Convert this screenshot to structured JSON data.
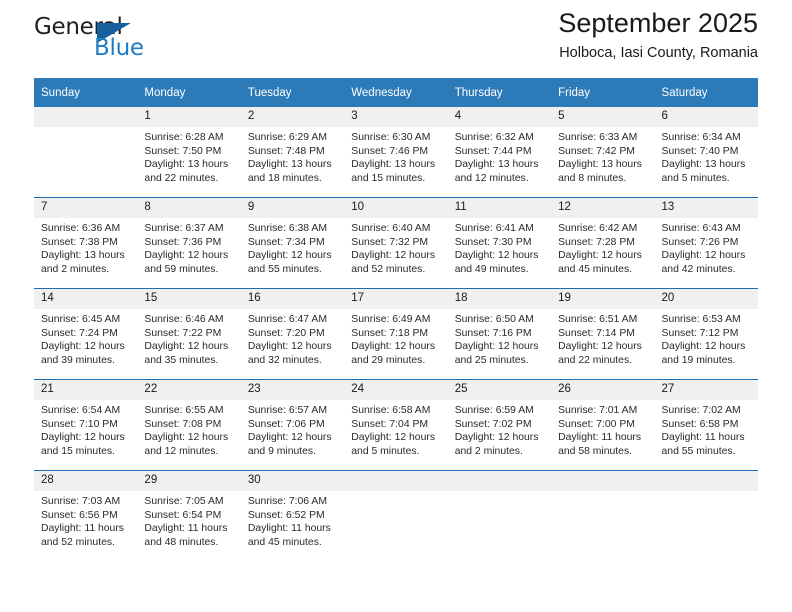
{
  "brand": {
    "word_one": "General",
    "word_two": "Blue",
    "triangle_icon": "blue-triangle-icon"
  },
  "header": {
    "month_title": "September 2025",
    "location": "Holboca, Iasi County, Romania"
  },
  "colors": {
    "header_blue": "#2d7ab8",
    "week_divider_blue": "#1f6cb0",
    "daynum_band": "#f0f0f0",
    "brand_blue": "#1f7cc4",
    "brand_dark": "#231f20",
    "text": "#1a1a1a"
  },
  "calendar": {
    "weekday_headers": [
      "Sunday",
      "Monday",
      "Tuesday",
      "Wednesday",
      "Thursday",
      "Friday",
      "Saturday"
    ],
    "weeks": [
      [
        {
          "day": "",
          "empty": true,
          "sunrise": "",
          "sunset": "",
          "daylight_line1": "",
          "daylight_line2": ""
        },
        {
          "day": "1",
          "sunrise": "Sunrise: 6:28 AM",
          "sunset": "Sunset: 7:50 PM",
          "daylight_line1": "Daylight: 13 hours",
          "daylight_line2": "and 22 minutes."
        },
        {
          "day": "2",
          "sunrise": "Sunrise: 6:29 AM",
          "sunset": "Sunset: 7:48 PM",
          "daylight_line1": "Daylight: 13 hours",
          "daylight_line2": "and 18 minutes."
        },
        {
          "day": "3",
          "sunrise": "Sunrise: 6:30 AM",
          "sunset": "Sunset: 7:46 PM",
          "daylight_line1": "Daylight: 13 hours",
          "daylight_line2": "and 15 minutes."
        },
        {
          "day": "4",
          "sunrise": "Sunrise: 6:32 AM",
          "sunset": "Sunset: 7:44 PM",
          "daylight_line1": "Daylight: 13 hours",
          "daylight_line2": "and 12 minutes."
        },
        {
          "day": "5",
          "sunrise": "Sunrise: 6:33 AM",
          "sunset": "Sunset: 7:42 PM",
          "daylight_line1": "Daylight: 13 hours",
          "daylight_line2": "and 8 minutes."
        },
        {
          "day": "6",
          "sunrise": "Sunrise: 6:34 AM",
          "sunset": "Sunset: 7:40 PM",
          "daylight_line1": "Daylight: 13 hours",
          "daylight_line2": "and 5 minutes."
        }
      ],
      [
        {
          "day": "7",
          "sunrise": "Sunrise: 6:36 AM",
          "sunset": "Sunset: 7:38 PM",
          "daylight_line1": "Daylight: 13 hours",
          "daylight_line2": "and 2 minutes."
        },
        {
          "day": "8",
          "sunrise": "Sunrise: 6:37 AM",
          "sunset": "Sunset: 7:36 PM",
          "daylight_line1": "Daylight: 12 hours",
          "daylight_line2": "and 59 minutes."
        },
        {
          "day": "9",
          "sunrise": "Sunrise: 6:38 AM",
          "sunset": "Sunset: 7:34 PM",
          "daylight_line1": "Daylight: 12 hours",
          "daylight_line2": "and 55 minutes."
        },
        {
          "day": "10",
          "sunrise": "Sunrise: 6:40 AM",
          "sunset": "Sunset: 7:32 PM",
          "daylight_line1": "Daylight: 12 hours",
          "daylight_line2": "and 52 minutes."
        },
        {
          "day": "11",
          "sunrise": "Sunrise: 6:41 AM",
          "sunset": "Sunset: 7:30 PM",
          "daylight_line1": "Daylight: 12 hours",
          "daylight_line2": "and 49 minutes."
        },
        {
          "day": "12",
          "sunrise": "Sunrise: 6:42 AM",
          "sunset": "Sunset: 7:28 PM",
          "daylight_line1": "Daylight: 12 hours",
          "daylight_line2": "and 45 minutes."
        },
        {
          "day": "13",
          "sunrise": "Sunrise: 6:43 AM",
          "sunset": "Sunset: 7:26 PM",
          "daylight_line1": "Daylight: 12 hours",
          "daylight_line2": "and 42 minutes."
        }
      ],
      [
        {
          "day": "14",
          "sunrise": "Sunrise: 6:45 AM",
          "sunset": "Sunset: 7:24 PM",
          "daylight_line1": "Daylight: 12 hours",
          "daylight_line2": "and 39 minutes."
        },
        {
          "day": "15",
          "sunrise": "Sunrise: 6:46 AM",
          "sunset": "Sunset: 7:22 PM",
          "daylight_line1": "Daylight: 12 hours",
          "daylight_line2": "and 35 minutes."
        },
        {
          "day": "16",
          "sunrise": "Sunrise: 6:47 AM",
          "sunset": "Sunset: 7:20 PM",
          "daylight_line1": "Daylight: 12 hours",
          "daylight_line2": "and 32 minutes."
        },
        {
          "day": "17",
          "sunrise": "Sunrise: 6:49 AM",
          "sunset": "Sunset: 7:18 PM",
          "daylight_line1": "Daylight: 12 hours",
          "daylight_line2": "and 29 minutes."
        },
        {
          "day": "18",
          "sunrise": "Sunrise: 6:50 AM",
          "sunset": "Sunset: 7:16 PM",
          "daylight_line1": "Daylight: 12 hours",
          "daylight_line2": "and 25 minutes."
        },
        {
          "day": "19",
          "sunrise": "Sunrise: 6:51 AM",
          "sunset": "Sunset: 7:14 PM",
          "daylight_line1": "Daylight: 12 hours",
          "daylight_line2": "and 22 minutes."
        },
        {
          "day": "20",
          "sunrise": "Sunrise: 6:53 AM",
          "sunset": "Sunset: 7:12 PM",
          "daylight_line1": "Daylight: 12 hours",
          "daylight_line2": "and 19 minutes."
        }
      ],
      [
        {
          "day": "21",
          "sunrise": "Sunrise: 6:54 AM",
          "sunset": "Sunset: 7:10 PM",
          "daylight_line1": "Daylight: 12 hours",
          "daylight_line2": "and 15 minutes."
        },
        {
          "day": "22",
          "sunrise": "Sunrise: 6:55 AM",
          "sunset": "Sunset: 7:08 PM",
          "daylight_line1": "Daylight: 12 hours",
          "daylight_line2": "and 12 minutes."
        },
        {
          "day": "23",
          "sunrise": "Sunrise: 6:57 AM",
          "sunset": "Sunset: 7:06 PM",
          "daylight_line1": "Daylight: 12 hours",
          "daylight_line2": "and 9 minutes."
        },
        {
          "day": "24",
          "sunrise": "Sunrise: 6:58 AM",
          "sunset": "Sunset: 7:04 PM",
          "daylight_line1": "Daylight: 12 hours",
          "daylight_line2": "and 5 minutes."
        },
        {
          "day": "25",
          "sunrise": "Sunrise: 6:59 AM",
          "sunset": "Sunset: 7:02 PM",
          "daylight_line1": "Daylight: 12 hours",
          "daylight_line2": "and 2 minutes."
        },
        {
          "day": "26",
          "sunrise": "Sunrise: 7:01 AM",
          "sunset": "Sunset: 7:00 PM",
          "daylight_line1": "Daylight: 11 hours",
          "daylight_line2": "and 58 minutes."
        },
        {
          "day": "27",
          "sunrise": "Sunrise: 7:02 AM",
          "sunset": "Sunset: 6:58 PM",
          "daylight_line1": "Daylight: 11 hours",
          "daylight_line2": "and 55 minutes."
        }
      ],
      [
        {
          "day": "28",
          "sunrise": "Sunrise: 7:03 AM",
          "sunset": "Sunset: 6:56 PM",
          "daylight_line1": "Daylight: 11 hours",
          "daylight_line2": "and 52 minutes."
        },
        {
          "day": "29",
          "sunrise": "Sunrise: 7:05 AM",
          "sunset": "Sunset: 6:54 PM",
          "daylight_line1": "Daylight: 11 hours",
          "daylight_line2": "and 48 minutes."
        },
        {
          "day": "30",
          "sunrise": "Sunrise: 7:06 AM",
          "sunset": "Sunset: 6:52 PM",
          "daylight_line1": "Daylight: 11 hours",
          "daylight_line2": "and 45 minutes."
        },
        {
          "day": "",
          "empty": true,
          "sunrise": "",
          "sunset": "",
          "daylight_line1": "",
          "daylight_line2": ""
        },
        {
          "day": "",
          "empty": true,
          "sunrise": "",
          "sunset": "",
          "daylight_line1": "",
          "daylight_line2": ""
        },
        {
          "day": "",
          "empty": true,
          "sunrise": "",
          "sunset": "",
          "daylight_line1": "",
          "daylight_line2": ""
        },
        {
          "day": "",
          "empty": true,
          "sunrise": "",
          "sunset": "",
          "daylight_line1": "",
          "daylight_line2": ""
        }
      ]
    ]
  }
}
